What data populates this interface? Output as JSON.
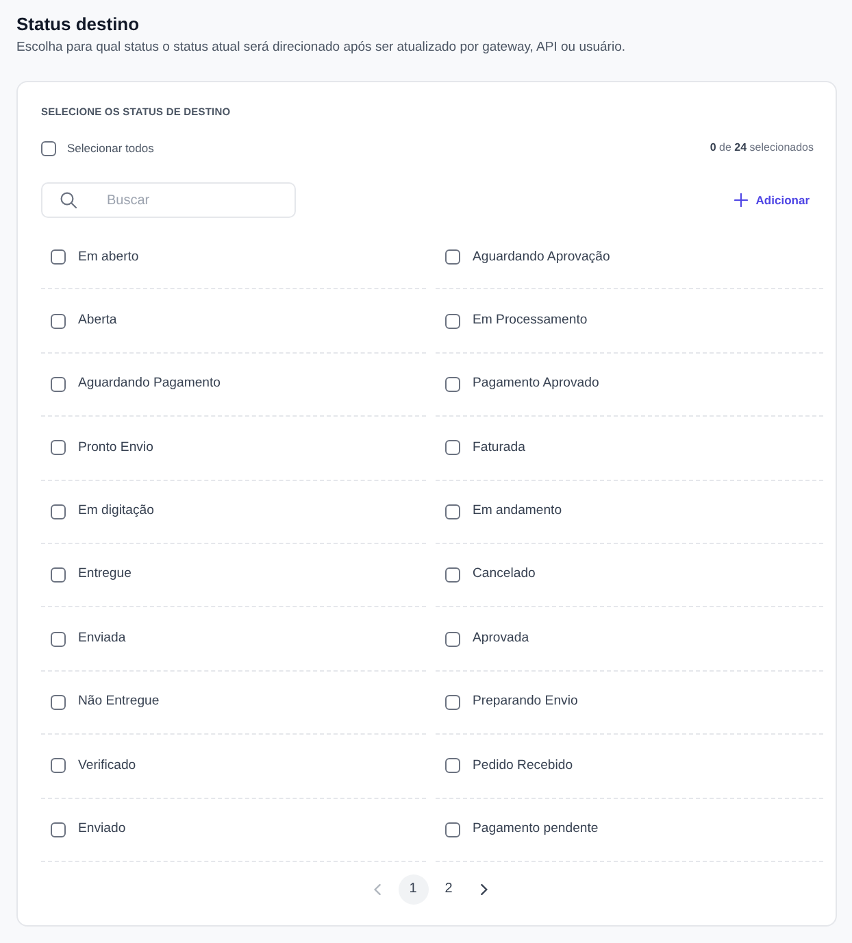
{
  "header": {
    "title": "Status destino",
    "subtitle": "Escolha para qual status o status atual será direcionado após ser atualizado por gateway, API ou usuário."
  },
  "panel": {
    "heading": "SELECIONE OS STATUS DE DESTINO",
    "select_all": {
      "label": "Selecionar todos",
      "checked": false
    },
    "counter": "**0** de **24** selecionados",
    "search": {
      "placeholder": "Buscar"
    },
    "add_button": "Adicionar",
    "statuses": [
      {
        "label": "Em aberto",
        "checked": false
      },
      {
        "label": "Aguardando Aprovação",
        "checked": false
      },
      {
        "label": "Aberta",
        "checked": false
      },
      {
        "label": "Em Processamento",
        "checked": false
      },
      {
        "label": "Aguardando Pagamento",
        "checked": false
      },
      {
        "label": "Pagamento Aprovado",
        "checked": false
      },
      {
        "label": "Pronto Envio",
        "checked": false
      },
      {
        "label": "Faturada",
        "checked": false
      },
      {
        "label": "Em digitação",
        "checked": false
      },
      {
        "label": "Em andamento",
        "checked": false
      },
      {
        "label": "Entregue",
        "checked": false
      },
      {
        "label": "Cancelado",
        "checked": false
      },
      {
        "label": "Enviada",
        "checked": false
      },
      {
        "label": "Aprovada",
        "checked": false
      },
      {
        "label": "Não Entregue",
        "checked": false
      },
      {
        "label": "Preparando Envio",
        "checked": false
      },
      {
        "label": "Verificado",
        "checked": false
      },
      {
        "label": "Pedido Recebido",
        "checked": false
      },
      {
        "label": "Enviado",
        "checked": false
      },
      {
        "label": "Pagamento pendente",
        "checked": false
      }
    ],
    "pagination": {
      "previous": {
        "disabled": true
      },
      "pages": [
        {
          "label": "1",
          "selected": true
        },
        {
          "label": "2",
          "selected": false
        }
      ],
      "next": {
        "disabled": false
      }
    }
  }
}
